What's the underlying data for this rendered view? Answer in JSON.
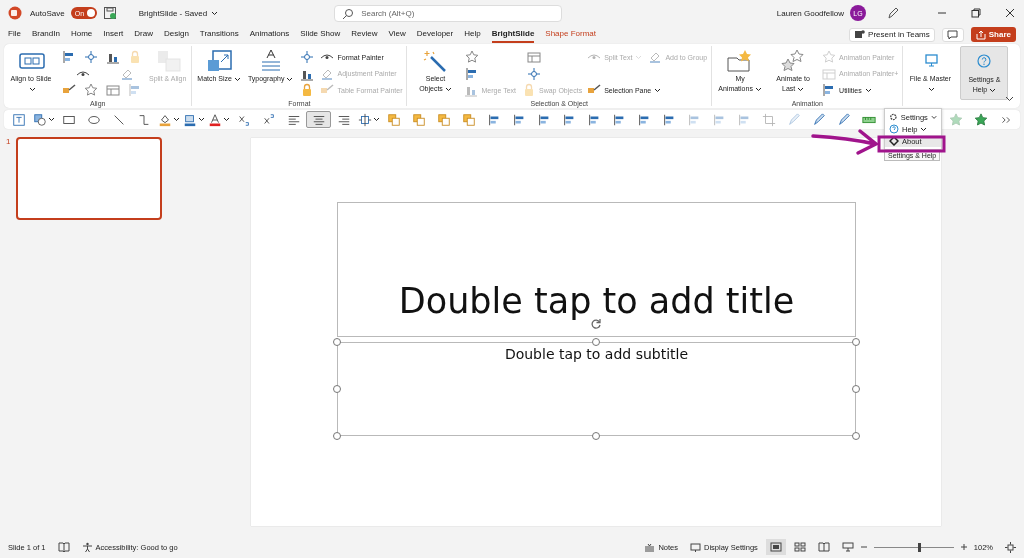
{
  "title_bar": {
    "autosave_label": "AutoSave",
    "autosave": {
      "on": true,
      "label": "On"
    },
    "document": "BrightSlide - Saved",
    "search": {
      "placeholder": "Search (Alt+Q)"
    },
    "user": {
      "name": "Lauren Goodfellow",
      "initials": "LG"
    }
  },
  "tabs": [
    {
      "label": "File",
      "selected": false,
      "kind": "standard"
    },
    {
      "label": "BrandIn",
      "selected": false,
      "kind": "standard"
    },
    {
      "label": "Home",
      "selected": false,
      "kind": "standard"
    },
    {
      "label": "Insert",
      "selected": false,
      "kind": "standard"
    },
    {
      "label": "Draw",
      "selected": false,
      "kind": "standard"
    },
    {
      "label": "Design",
      "selected": false,
      "kind": "standard"
    },
    {
      "label": "Transitions",
      "selected": false,
      "kind": "standard"
    },
    {
      "label": "Animations",
      "selected": false,
      "kind": "standard"
    },
    {
      "label": "Slide Show",
      "selected": false,
      "kind": "standard"
    },
    {
      "label": "Review",
      "selected": false,
      "kind": "standard"
    },
    {
      "label": "View",
      "selected": false,
      "kind": "standard"
    },
    {
      "label": "Developer",
      "selected": false,
      "kind": "standard"
    },
    {
      "label": "Help",
      "selected": false,
      "kind": "standard"
    },
    {
      "label": "BrightSlide",
      "selected": true,
      "kind": "standard"
    },
    {
      "label": "Shape Format",
      "selected": false,
      "kind": "contextual"
    }
  ],
  "tab_actions": {
    "present": "Present in Teams",
    "share": "Share"
  },
  "ribbon": [
    {
      "label": "Align",
      "columns": [
        {
          "kind": "large",
          "items": [
            {
              "label": "Align to Slide",
              "caret": true,
              "disabled": false,
              "pressed": false
            }
          ]
        },
        {
          "kind": "stack",
          "rows": [
            [
              {
                "disabled": false
              },
              {
                "disabled": false
              },
              {
                "disabled": false
              },
              {
                "disabled": true
              }
            ],
            [
              {
                "disabled": false
              },
              {
                "disabled": true
              }
            ],
            [
              {
                "disabled": false
              },
              {
                "disabled": false
              },
              {
                "disabled": false
              },
              {
                "disabled": true
              }
            ]
          ]
        },
        {
          "kind": "large",
          "items": [
            {
              "label": "Split & Align",
              "caret": false,
              "disabled": true,
              "pressed": false
            }
          ]
        }
      ]
    },
    {
      "label": "Format",
      "columns": [
        {
          "kind": "large",
          "items": [
            {
              "label": "Match Size",
              "caret": true,
              "disabled": false,
              "pressed": false
            }
          ]
        },
        {
          "kind": "large",
          "items": [
            {
              "label": "Typography",
              "caret": true,
              "disabled": false,
              "pressed": false
            }
          ]
        },
        {
          "kind": "stack",
          "rows": [
            [
              {
                "disabled": false
              }
            ],
            [
              {
                "disabled": false
              }
            ],
            [
              {
                "disabled": false
              }
            ]
          ]
        },
        {
          "kind": "stack",
          "rows": [
            [
              {
                "label": "Format Painter",
                "caret": false,
                "disabled": false
              }
            ],
            [
              {
                "label": "Adjustment Painter",
                "caret": false,
                "disabled": true
              }
            ],
            [
              {
                "label": "Table Format Painter",
                "caret": false,
                "disabled": true
              }
            ]
          ]
        }
      ]
    },
    {
      "label": "Selection & Object",
      "columns": [
        {
          "kind": "large",
          "items": [
            {
              "label": "Select Objects",
              "caret": true,
              "disabled": false,
              "pressed": false
            }
          ]
        },
        {
          "kind": "stack",
          "rows": [
            [
              {
                "disabled": false
              },
              {
                "disabled": false
              }
            ],
            [
              {
                "disabled": false
              },
              {
                "disabled": false
              }
            ],
            [
              {
                "label": "Merge Text",
                "caret": false,
                "disabled": true
              },
              {
                "label": "Swap Objects",
                "caret": false,
                "disabled": true
              }
            ]
          ]
        },
        {
          "kind": "stack",
          "rows": [
            [
              {
                "label": "Split Text",
                "caret": true,
                "disabled": true
              },
              {
                "label": "Add to Group",
                "caret": false,
                "disabled": true
              }
            ],
            [
              {
                "label": "Selection Pane",
                "caret": true,
                "disabled": false
              }
            ]
          ]
        }
      ]
    },
    {
      "label": "Animation",
      "columns": [
        {
          "kind": "large",
          "items": [
            {
              "label": "My Animations",
              "caret": true,
              "disabled": false,
              "pressed": false
            }
          ]
        },
        {
          "kind": "large",
          "items": [
            {
              "label": "Animate to Last",
              "caret": true,
              "disabled": false,
              "pressed": false
            }
          ]
        },
        {
          "kind": "stack",
          "rows": [
            [
              {
                "label": "Animation Painter",
                "caret": false,
                "disabled": true
              }
            ],
            [
              {
                "label": "Animation Painter+",
                "caret": false,
                "disabled": true
              }
            ],
            [
              {
                "label": "Utilities",
                "caret": true,
                "disabled": false
              }
            ]
          ]
        }
      ]
    },
    {
      "columns": [
        {
          "kind": "large",
          "items": [
            {
              "label": "File & Master",
              "caret": true,
              "disabled": false,
              "pressed": false
            }
          ]
        },
        {
          "kind": "large",
          "items": [
            {
              "label": "Settings & Help",
              "caret": true,
              "disabled": false,
              "pressed": true
            }
          ]
        }
      ]
    }
  ],
  "toolbar": [
    {
      "kind": "textbox",
      "selected": false,
      "disabled": false
    },
    {
      "kind": "shapes",
      "selected": false,
      "disabled": false
    },
    {
      "kind": "rectangle",
      "selected": false,
      "disabled": false
    },
    {
      "kind": "ellipse",
      "selected": false,
      "disabled": false
    },
    {
      "kind": "line",
      "selected": false,
      "disabled": false
    },
    {
      "kind": "elbow",
      "selected": false,
      "disabled": false
    },
    {
      "kind": "fill",
      "selected": false,
      "disabled": false
    },
    {
      "kind": "outline",
      "selected": false,
      "disabled": false
    },
    {
      "kind": "font-color",
      "selected": false,
      "disabled": false
    },
    {
      "kind": "subscript",
      "selected": false,
      "disabled": false
    },
    {
      "kind": "superscript",
      "selected": false,
      "disabled": false
    },
    {
      "kind": "align-left",
      "selected": false,
      "disabled": false
    },
    {
      "kind": "align-center",
      "selected": true,
      "disabled": false
    },
    {
      "kind": "align-right",
      "selected": false,
      "disabled": false
    },
    {
      "kind": "distribute",
      "selected": false,
      "disabled": false
    },
    {
      "kind": "layers",
      "selected": false,
      "disabled": false
    },
    {
      "kind": "layers",
      "selected": false,
      "disabled": false
    },
    {
      "kind": "layers",
      "selected": false,
      "disabled": false
    },
    {
      "kind": "layers",
      "selected": false,
      "disabled": false
    },
    {
      "kind": "align",
      "selected": false,
      "disabled": false
    },
    {
      "kind": "align",
      "selected": false,
      "disabled": false
    },
    {
      "kind": "align",
      "selected": false,
      "disabled": false
    },
    {
      "kind": "align",
      "selected": false,
      "disabled": false
    },
    {
      "kind": "align",
      "selected": false,
      "disabled": false
    },
    {
      "kind": "align",
      "selected": false,
      "disabled": false
    },
    {
      "kind": "align",
      "selected": false,
      "disabled": false
    },
    {
      "kind": "align",
      "selected": false,
      "disabled": false
    },
    {
      "kind": "align",
      "selected": false,
      "disabled": true
    },
    {
      "kind": "align",
      "selected": false,
      "disabled": true
    },
    {
      "kind": "align",
      "selected": false,
      "disabled": true
    },
    {
      "kind": "crop",
      "selected": false,
      "disabled": true
    },
    {
      "kind": "pen",
      "selected": false,
      "disabled": true
    },
    {
      "kind": "pen",
      "selected": false,
      "disabled": false
    },
    {
      "kind": "pen",
      "selected": false,
      "disabled": false
    },
    {
      "kind": "ruler",
      "selected": false,
      "disabled": false
    }
  ],
  "toolbar_end": [
    {
      "kind": "star",
      "disabled": true
    },
    {
      "kind": "star",
      "disabled": false
    },
    {
      "kind": "more",
      "disabled": false
    }
  ],
  "menu": {
    "items": [
      {
        "label": "Settings",
        "caret": true,
        "selected": false
      },
      {
        "label": "Help",
        "caret": true,
        "selected": false
      },
      {
        "label": "About",
        "caret": false,
        "selected": true
      }
    ],
    "tooltip": "Settings & Help"
  },
  "thumbnails": [
    {
      "number": "1",
      "selected": true
    }
  ],
  "slide": {
    "title": "Double tap to add title",
    "subtitle": "Double tap to add subtitle"
  },
  "status_bar": {
    "slide": "Slide 1 of 1",
    "accessibility": "Accessibility: Good to go",
    "notes": "Notes",
    "display": "Display Settings",
    "views": [
      {
        "selected": true
      },
      {
        "selected": false
      },
      {
        "selected": false
      },
      {
        "selected": false
      }
    ],
    "zoom": {
      "level": 0.58,
      "label": "102%"
    }
  }
}
